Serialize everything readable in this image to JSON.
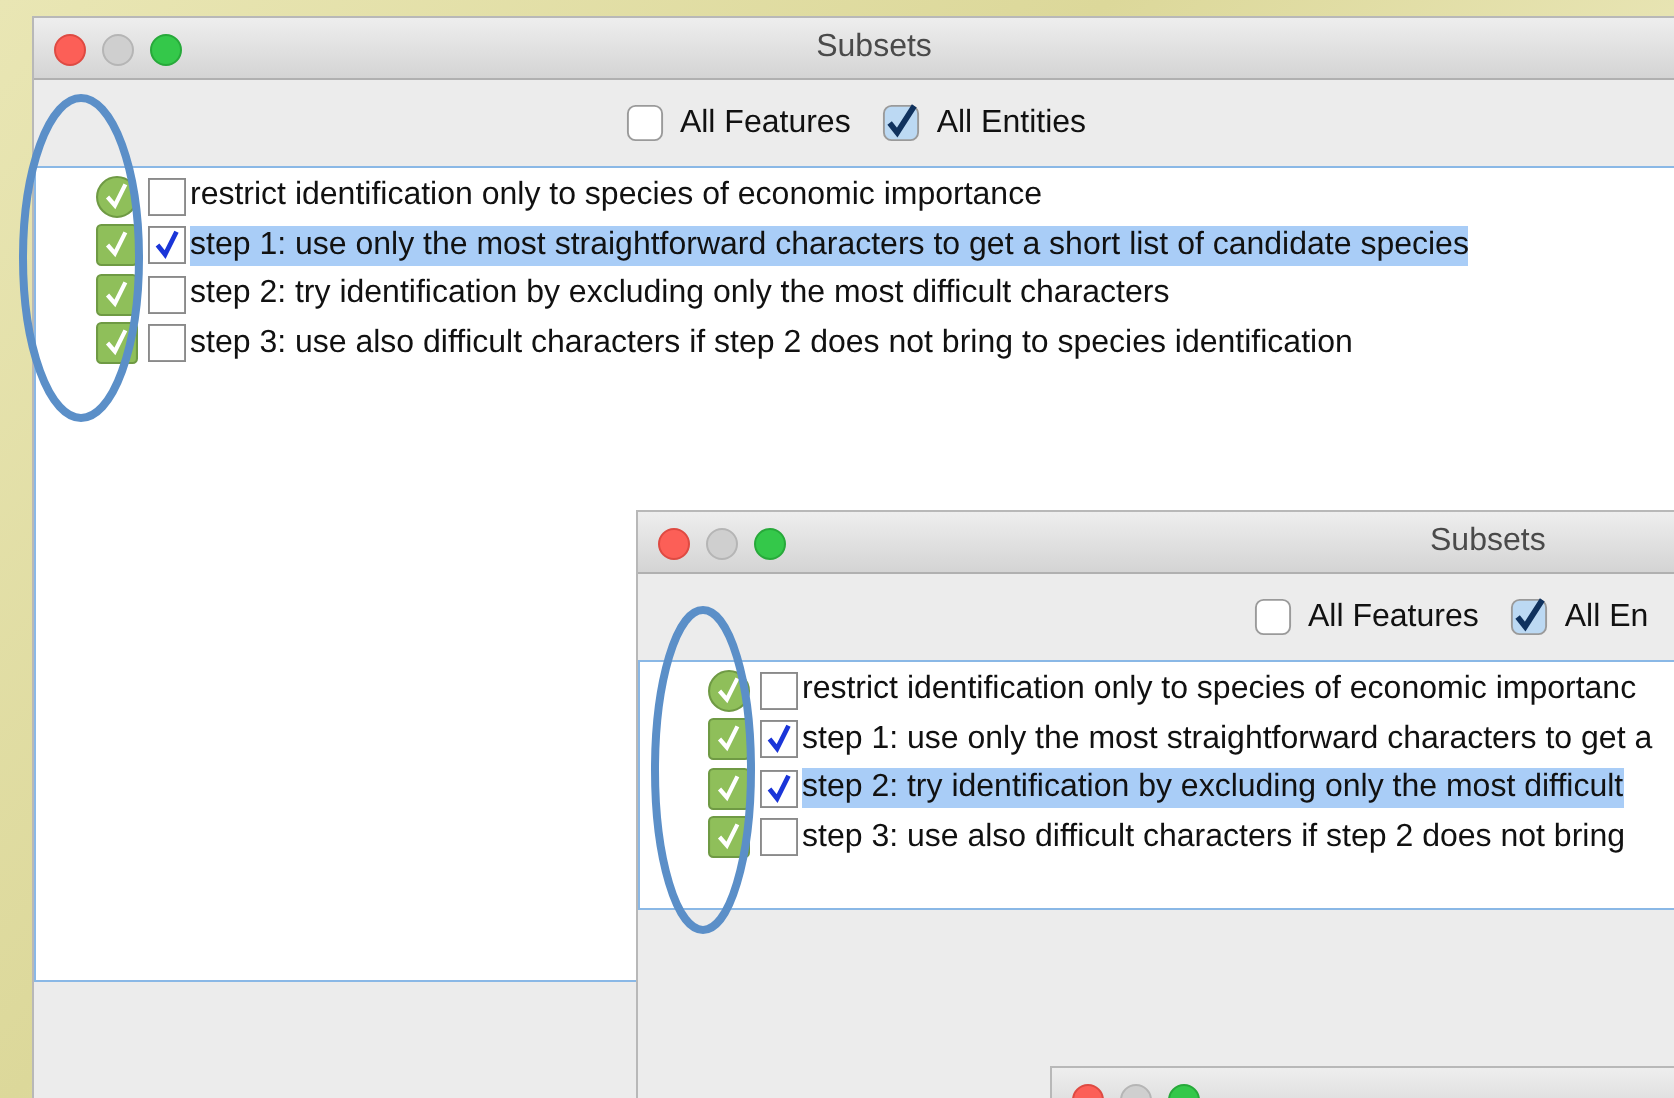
{
  "windows": [
    {
      "title": "Subsets",
      "toggles": [
        {
          "label": "All Features",
          "checked": false
        },
        {
          "label": "All Entities",
          "checked": true
        }
      ],
      "rows": [
        {
          "kind": "round",
          "checked": false,
          "selected": false,
          "text": "restrict identification only to species of economic importance"
        },
        {
          "kind": "square",
          "checked": true,
          "selected": true,
          "text": "step 1: use only the most straightforward characters to get a short list of candidate species"
        },
        {
          "kind": "square",
          "checked": false,
          "selected": false,
          "text": "step 2: try identification by excluding only the most difficult characters"
        },
        {
          "kind": "square",
          "checked": false,
          "selected": false,
          "text": "step 3: use also difficult characters if step 2 does not bring to species identification"
        }
      ]
    },
    {
      "title": "Subsets",
      "toggles": [
        {
          "label": "All Features",
          "checked": false
        },
        {
          "label": "All En",
          "checked": true
        }
      ],
      "rows": [
        {
          "kind": "round",
          "checked": false,
          "selected": false,
          "text": "restrict identification only to species of economic importanc"
        },
        {
          "kind": "square",
          "checked": true,
          "selected": false,
          "text": "step 1: use only the most straightforward characters to get a"
        },
        {
          "kind": "square",
          "checked": true,
          "selected": true,
          "text": "step 2: try identification by excluding only the most difficult"
        },
        {
          "kind": "square",
          "checked": false,
          "selected": false,
          "text": "step 3: use also difficult characters if step 2 does not bring"
        }
      ]
    }
  ]
}
